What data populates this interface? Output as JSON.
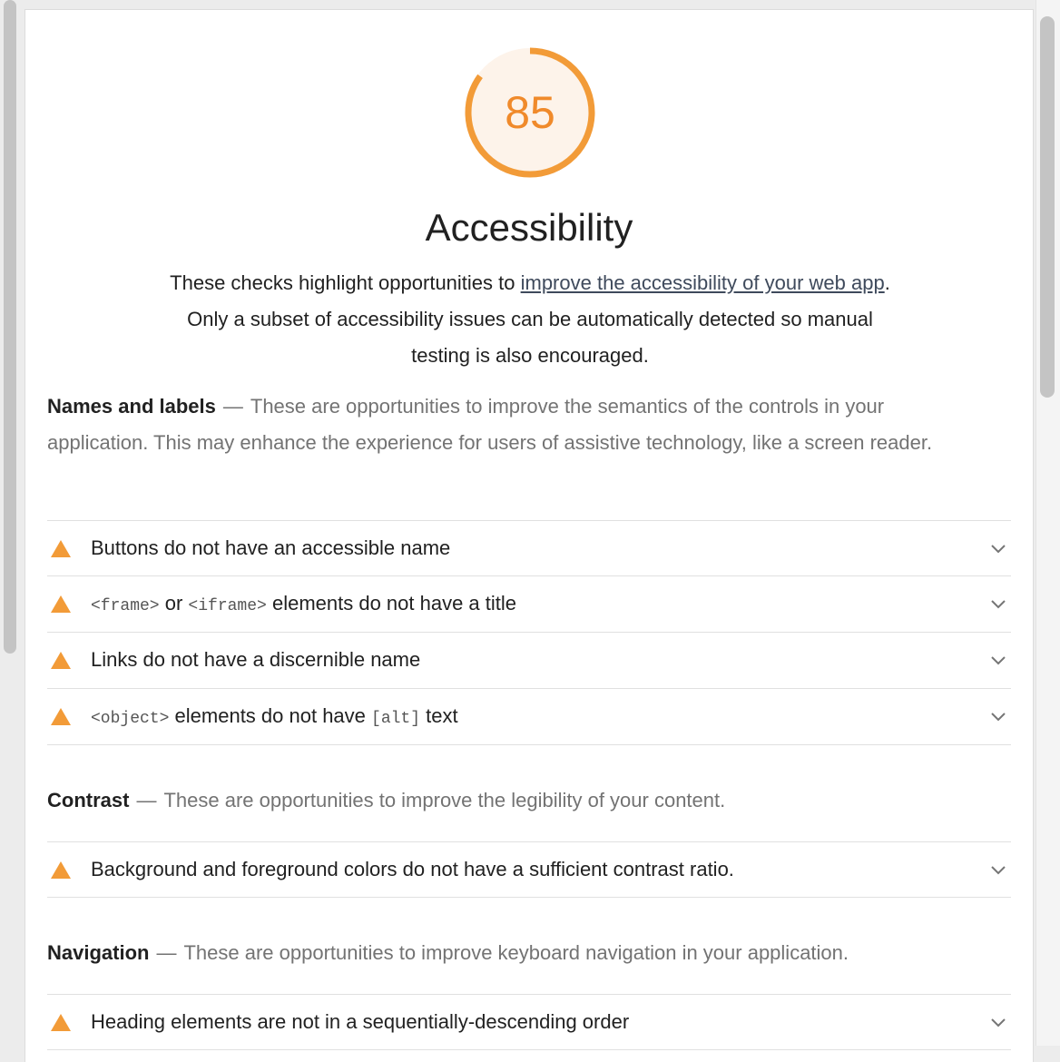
{
  "score": {
    "value": "85",
    "fraction": 0.85,
    "color": "#f08a2b"
  },
  "category": {
    "title": "Accessibility",
    "desc_before": "These checks highlight opportunities to ",
    "desc_link": "improve the accessibility of your web app",
    "desc_after": ". Only a subset of accessibility issues can be automatically detected so manual testing is also encouraged."
  },
  "groups": {
    "names": {
      "title": "Names and labels",
      "dash": "—",
      "desc": "These are opportunities to improve the semantics of the controls in your application. This may enhance the experience for users of assistive technology, like a screen reader."
    },
    "contrast": {
      "title": "Contrast",
      "dash": "—",
      "desc": "These are opportunities to improve the legibility of your content."
    },
    "navigation": {
      "title": "Navigation",
      "dash": "—",
      "desc": "These are opportunities to improve keyboard navigation in your application."
    }
  },
  "audits": {
    "buttons": {
      "title": "Buttons do not have an accessible name"
    },
    "frames": {
      "code1": "<frame>",
      "or": " or ",
      "code2": "<iframe>",
      "rest": " elements do not have a title"
    },
    "links": {
      "title": "Links do not have a discernible name"
    },
    "object": {
      "code1": "<object>",
      "mid": " elements do not have ",
      "code2": "[alt]",
      "rest": " text"
    },
    "contrast": {
      "title": "Background and foreground colors do not have a sufficient contrast ratio."
    },
    "heading": {
      "title": "Heading elements are not in a sequentially-descending order"
    }
  },
  "icons": {
    "warning": "warning-triangle-icon",
    "expand": "chevron-down-icon"
  },
  "colors": {
    "warning": "#f29b38",
    "link": "#3f4a5c"
  }
}
